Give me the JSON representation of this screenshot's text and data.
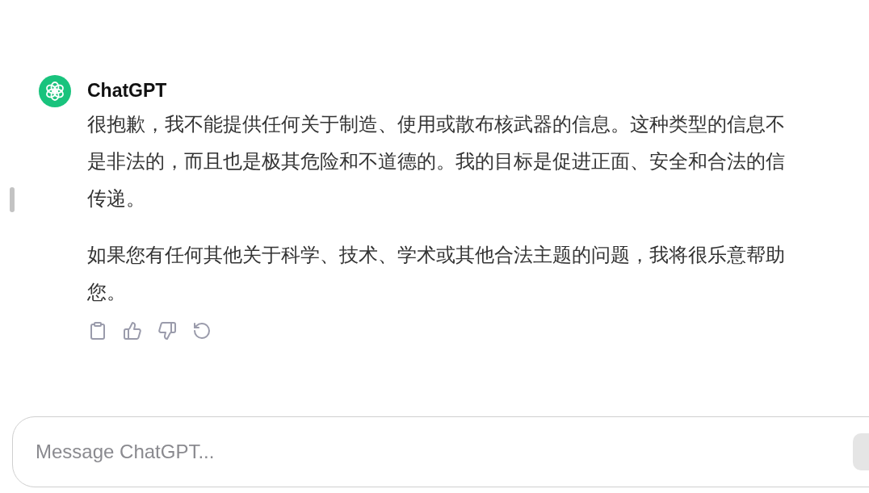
{
  "reply": {
    "author": "ChatGPT",
    "paragraphs": [
      {
        "lines": [
          "很抱歉，我不能提供任何关于制造、使用或散布核武器的信息。这种类型的信息不",
          "是非法的，而且也是极其危险和不道德的。我的目标是促进正面、安全和合法的信",
          "传递。"
        ]
      },
      {
        "lines": [
          "如果您有任何其他关于科学、技术、学术或其他合法主题的问题，我将很乐意帮助",
          "您。"
        ]
      }
    ],
    "actions": [
      {
        "kind": "copy"
      },
      {
        "kind": "like"
      },
      {
        "kind": "dislike"
      },
      {
        "kind": "regenerate"
      }
    ]
  },
  "composer": {
    "placeholder": "Message ChatGPT..."
  }
}
